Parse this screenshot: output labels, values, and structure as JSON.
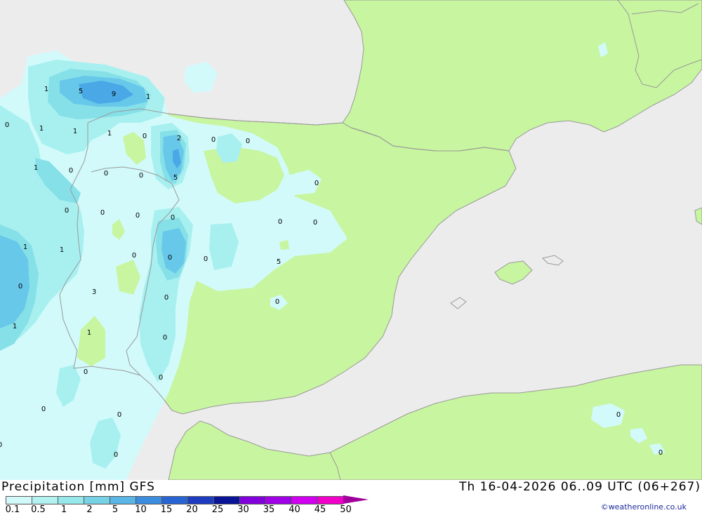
{
  "title": "Precipitation [mm]  GFS",
  "validity": "Th 16-04-2026 06..09 UTC (06+267)",
  "credit": "©weatheronline.co.uk",
  "colors": {
    "sea": "#ececec",
    "land": "#c8f5a0",
    "coast": "#999999"
  },
  "legend": {
    "ticks": [
      "0.1",
      "0.5",
      "1",
      "2",
      "5",
      "10",
      "15",
      "20",
      "25",
      "30",
      "35",
      "40",
      "45",
      "50"
    ],
    "colors": [
      "#d2fafa",
      "#b4f2f2",
      "#96e8ea",
      "#78d2e6",
      "#5ab6e4",
      "#3c8ce0",
      "#2864d2",
      "#1e3cc0",
      "#0a1496",
      "#8200dc",
      "#a000e6",
      "#d200f0",
      "#f000c8",
      "#a0009a"
    ]
  },
  "value_labels": [
    "1",
    "5",
    "9",
    "1",
    "0",
    "1",
    "1",
    "1",
    "0",
    "2",
    "0",
    "0",
    "1",
    "0",
    "0",
    "0",
    "5",
    "0",
    "0",
    "0",
    "0",
    "0",
    "1",
    "1",
    "0",
    "0",
    "0",
    "0",
    "0",
    "5",
    "0",
    "3",
    "0",
    "1",
    "1",
    "0",
    "0",
    "0",
    "0",
    "0",
    "0",
    "0",
    "0",
    "0",
    "0"
  ]
}
